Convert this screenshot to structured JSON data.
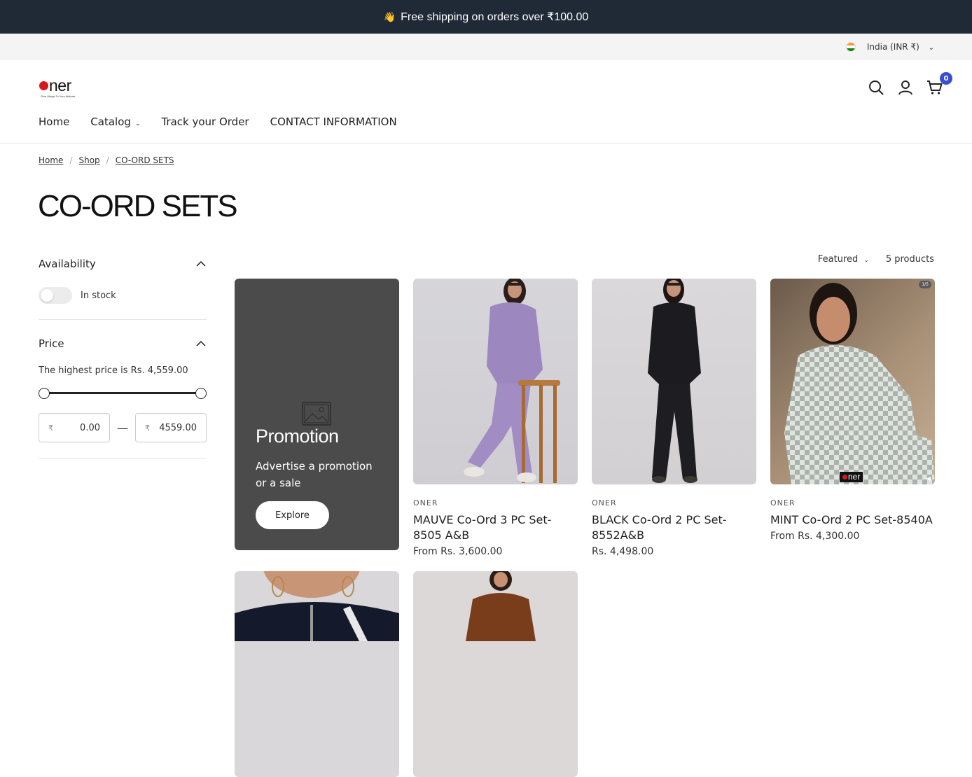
{
  "announcement": {
    "icon": "waving-hand-icon",
    "text": "Free shipping on orders over ₹100.00"
  },
  "locale": {
    "flag": "india-flag-icon",
    "label": "India (INR ₹)"
  },
  "header": {
    "logo": {
      "text": "ner",
      "tagline": "Give Wings To Your Attitude"
    },
    "cart_count": "0",
    "nav": [
      {
        "label": "Home"
      },
      {
        "label": "Catalog"
      },
      {
        "label": "Track your Order"
      },
      {
        "label": "CONTACT INFORMATION"
      }
    ]
  },
  "breadcrumb": [
    "Home",
    "Shop",
    "CO-ORD SETS"
  ],
  "page_title": "CO-ORD SETS",
  "filters": {
    "availability": {
      "label": "Availability",
      "toggle_label": "In stock",
      "in_stock_on": false
    },
    "price": {
      "label": "Price",
      "note": "The highest price is Rs. 4,559.00",
      "currency_symbol": "₹",
      "min": "0.00",
      "max": "4559.00",
      "range_fraction": [
        0,
        1
      ]
    }
  },
  "toolbar": {
    "sort": "Featured",
    "count": "5 products"
  },
  "promo": {
    "title": "Promotion",
    "text": "Advertise a promotion or a sale",
    "button": "Explore"
  },
  "products": [
    {
      "vendor": "ONER",
      "title": "MAUVE Co-Ord 3 PC Set-8505 A&B",
      "price": "From Rs. 3,600.00"
    },
    {
      "vendor": "ONER",
      "title": "BLACK Co-Ord 2 PC Set-8552A&B",
      "price": "Rs. 4,498.00"
    },
    {
      "vendor": "ONER",
      "title": "MINT Co-Ord 2 PC Set-8540A",
      "price": "From Rs. 4,300.00",
      "badge": "1/5",
      "image_tag": "ner"
    }
  ],
  "colors": {
    "announcement_bg": "#1f2a36",
    "cart_badge": "#3a4ed4",
    "promo_bg": "#4b4b4b",
    "logo_dot": "#d7191f"
  }
}
